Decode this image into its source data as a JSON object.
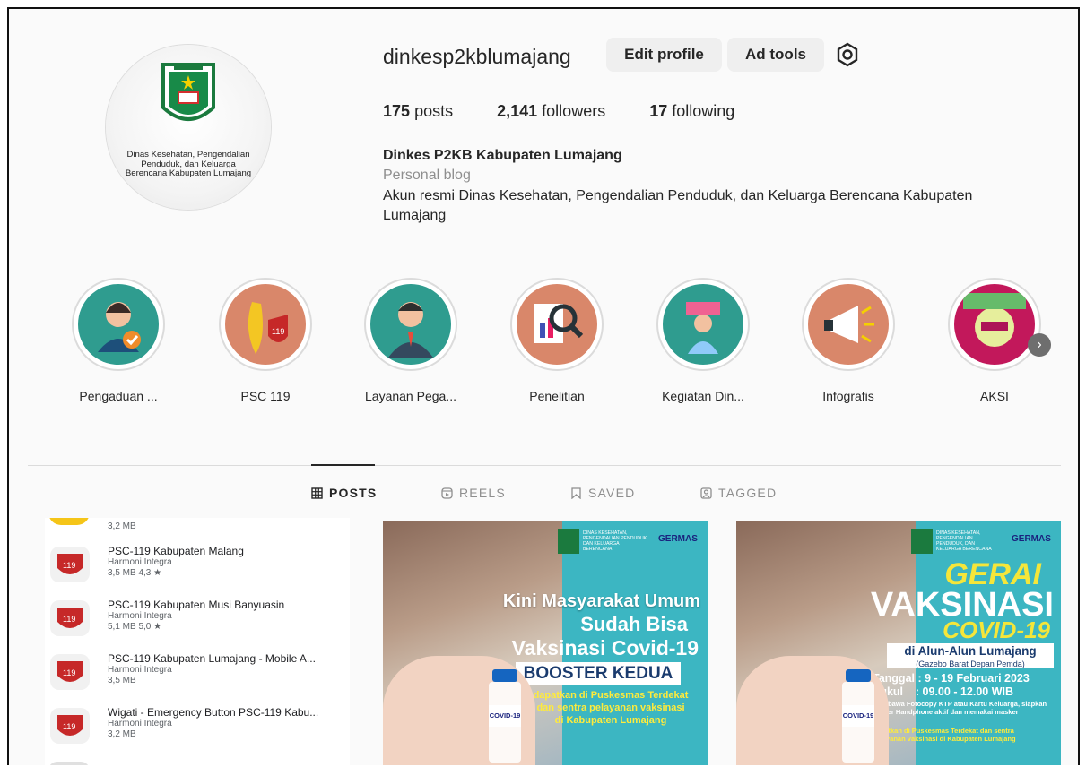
{
  "profile": {
    "username": "dinkesp2kblumajang",
    "edit_profile": "Edit profile",
    "ad_tools": "Ad tools",
    "stats": {
      "posts_count": "175",
      "posts_label": "posts",
      "followers_count": "2,141",
      "followers_label": "followers",
      "following_count": "17",
      "following_label": "following"
    },
    "full_name": "Dinkes P2KB Kabupaten Lumajang",
    "category": "Personal blog",
    "bio": "Akun resmi Dinas Kesehatan, Pengendalian Penduduk, dan Keluarga Berencana Kabupaten Lumajang",
    "avatar_caption": "Dinas Kesehatan, Pengendalian Penduduk, dan Keluarga Berencana Kabupaten Lumajang"
  },
  "highlights": [
    {
      "label": "Pengaduan ...",
      "color": "#2f9c8f",
      "icon": "support-agent-icon"
    },
    {
      "label": "PSC 119",
      "color": "#d9876a",
      "icon": "banana-mascot-icon"
    },
    {
      "label": "Layanan Pega...",
      "color": "#2f9c8f",
      "icon": "businessman-icon"
    },
    {
      "label": "Penelitian",
      "color": "#d9876a",
      "icon": "research-magnifier-icon"
    },
    {
      "label": "Kegiatan Din...",
      "color": "#2f9c8f",
      "icon": "sign-holder-icon"
    },
    {
      "label": "Infografis",
      "color": "#d9876a",
      "icon": "megaphone-icon"
    },
    {
      "label": "AKSI",
      "color": "#c2185b",
      "icon": "poster-icon"
    }
  ],
  "tabs": [
    {
      "label": "POSTS",
      "active": true,
      "icon": "grid-icon"
    },
    {
      "label": "REELS",
      "active": false,
      "icon": "reels-icon"
    },
    {
      "label": "SAVED",
      "active": false,
      "icon": "bookmark-icon"
    },
    {
      "label": "TAGGED",
      "active": false,
      "icon": "tag-icon"
    }
  ],
  "applist": {
    "top_size": "3,2 MB",
    "apps": [
      {
        "title": "PSC-119 Kabupaten Malang",
        "dev": "Harmoni Integra",
        "meta": "3,5 MB  4,3 ★"
      },
      {
        "title": "PSC-119 Kabupaten Musi Banyuasin",
        "dev": "Harmoni Integra",
        "meta": "5,1 MB  5,0 ★"
      },
      {
        "title": "PSC-119 Kabupaten Lumajang - Mobile A...",
        "dev": "Harmoni Integra",
        "meta": "3,5 MB"
      },
      {
        "title": "Wigati - Emergency Button PSC-119 Kabu...",
        "dev": "Harmoni Integra",
        "meta": "3,2 MB"
      }
    ]
  },
  "posts": [
    {
      "header_org": "DINAS KESEHATAN, PENGENDALIAN PENDUDUK DAN KELUARGA BERENCANA",
      "germas": "GERMAS",
      "line1": "Kini Masyarakat Umum",
      "line2": "Sudah Bisa",
      "line3": "Vaksinasi Covid-19",
      "line4": "BOOSTER KEDUA",
      "line5": "dapatkan di Puskesmas Terdekat",
      "line6": "dan sentra pelayanan vaksinasi",
      "line7": "di Kabupaten Lumajang",
      "vial": "COVID-19"
    },
    {
      "header_org": "DINAS KESEHATAN, PENGENDALIAN PENDUDUK, DAN KELUARGA BERENCANA",
      "germas": "GERMAS",
      "line1": "GERAI",
      "line2": "VAKSINASI",
      "line3": "COVID-19",
      "line4": "di Alun-Alun Lumajang",
      "line5": "(Gazebo Barat Depan Pemda)",
      "line6": "Tanggal : 9 - 19 Februari 2023",
      "line7": "Pukul    : 09.00 - 12.00 WIB",
      "line8": "Membawa Fotocopy KTP atau Kartu Keluarga, siapkan Nomer Handphone aktif dan memakai masker",
      "line9": "dapatkan di Puskesmas Terdekat dan sentra pelayanan vaksinasi di Kabupaten Lumajang",
      "vial": "COVID-19"
    }
  ]
}
